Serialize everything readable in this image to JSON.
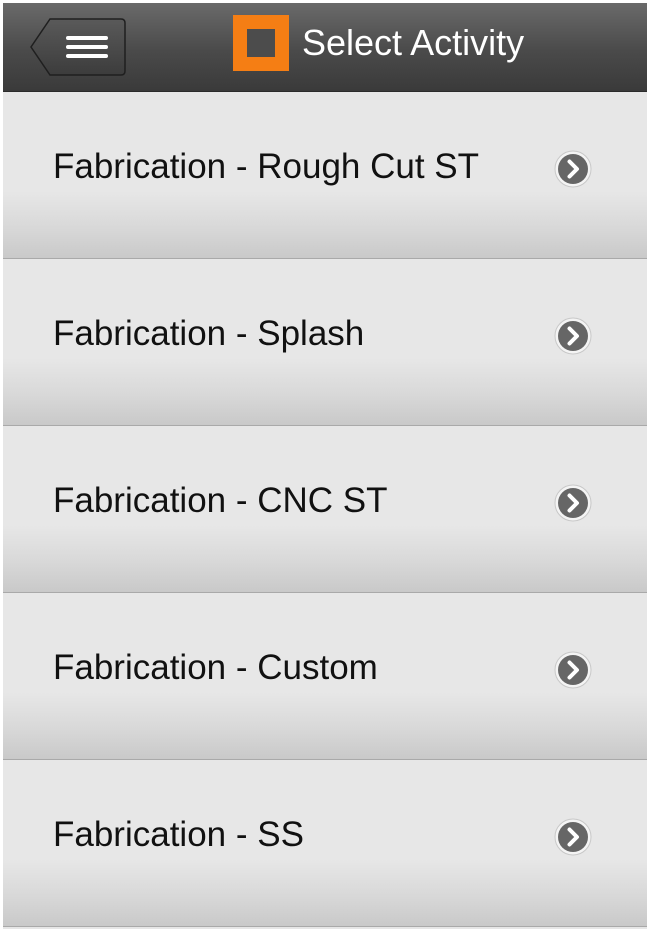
{
  "header": {
    "title": "Select Activity",
    "menu_icon": "hamburger-menu-icon",
    "logo_icon": "app-logo-icon",
    "logo_color": "#f57e14"
  },
  "activities": [
    {
      "label": "Fabrication - Rough Cut ST",
      "icon": "chevron-right-icon"
    },
    {
      "label": "Fabrication - Splash",
      "icon": "chevron-right-icon"
    },
    {
      "label": "Fabrication - CNC ST",
      "icon": "chevron-right-icon"
    },
    {
      "label": "Fabrication - Custom",
      "icon": "chevron-right-icon"
    },
    {
      "label": "Fabrication - SS",
      "icon": "chevron-right-icon"
    }
  ]
}
